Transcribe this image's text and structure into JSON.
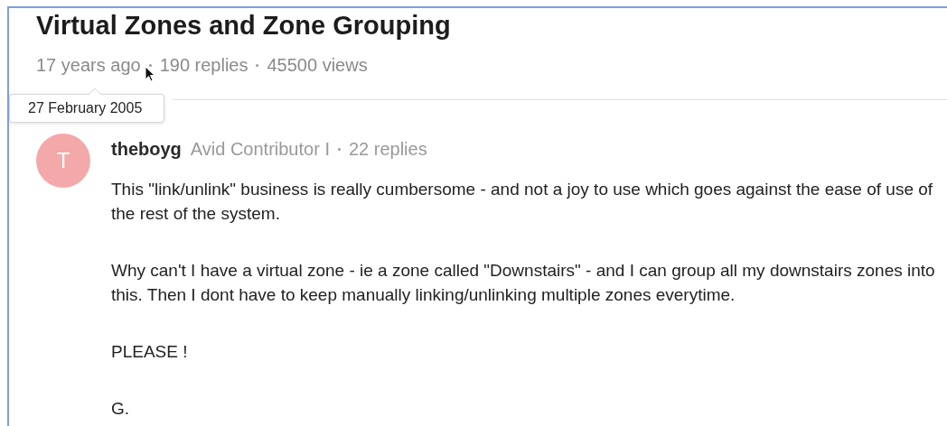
{
  "topic": {
    "title": "Virtual Zones and Zone Grouping",
    "meta": [
      "17 years ago",
      "190 replies",
      "45500 views"
    ],
    "tooltip": "27 February 2005"
  },
  "post": {
    "avatar_letter": "T",
    "author": "theboyg",
    "rank": "Avid Contributor I",
    "replies": "22 replies",
    "paragraphs": [
      "This \"link/unlink\" business is really cumbersome - and not a joy to use which goes against the ease of use of the rest of the system.",
      "Why can't I have a virtual zone - ie a zone called \"Downstairs\" - and I can group all my downstairs zones into this. Then I dont have to keep manually linking/unlinking multiple zones everytime.",
      "PLEASE !",
      "G."
    ]
  }
}
